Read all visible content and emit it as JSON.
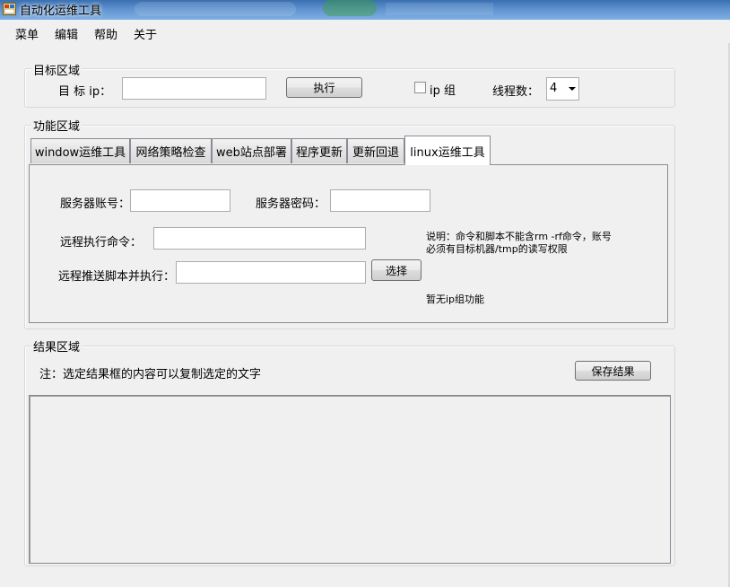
{
  "window": {
    "title": "自动化运维工具"
  },
  "menubar": {
    "items": [
      "菜单",
      "编辑",
      "帮助",
      "关于"
    ]
  },
  "target_group": {
    "title": "目标区域",
    "ip_label": "目 标 ip：",
    "ip_value": "",
    "execute_label": "执行",
    "ip_group_label": "ip 组",
    "ip_group_checked": false,
    "thread_label": "线程数：",
    "thread_value": "4"
  },
  "function_group": {
    "title": "功能区域",
    "tabs": [
      "window运维工具",
      "网络策略检查",
      "web站点部署",
      "程序更新",
      "更新回退",
      "linux运维工具"
    ],
    "active_tab": "linux运维工具",
    "server_account_label": "服务器账号：",
    "server_account_value": "",
    "server_password_label": "服务器密码：",
    "server_password_value": "",
    "remote_command_label": "远程执行命令：",
    "remote_command_value": "",
    "remote_script_label": "远程推送脚本并执行：",
    "remote_script_value": "",
    "select_label": "选择",
    "note_line1": "说明：命令和脚本不能含rm -rf命令，账号",
    "note_line2": "必须有目标机器/tmp的读写权限",
    "no_ip_group_note": "暂无ip组功能"
  },
  "result_group": {
    "title": "结果区域",
    "hint": "注：选定结果框的内容可以复制选定的文字",
    "save_label": "保存结果",
    "content": ""
  }
}
